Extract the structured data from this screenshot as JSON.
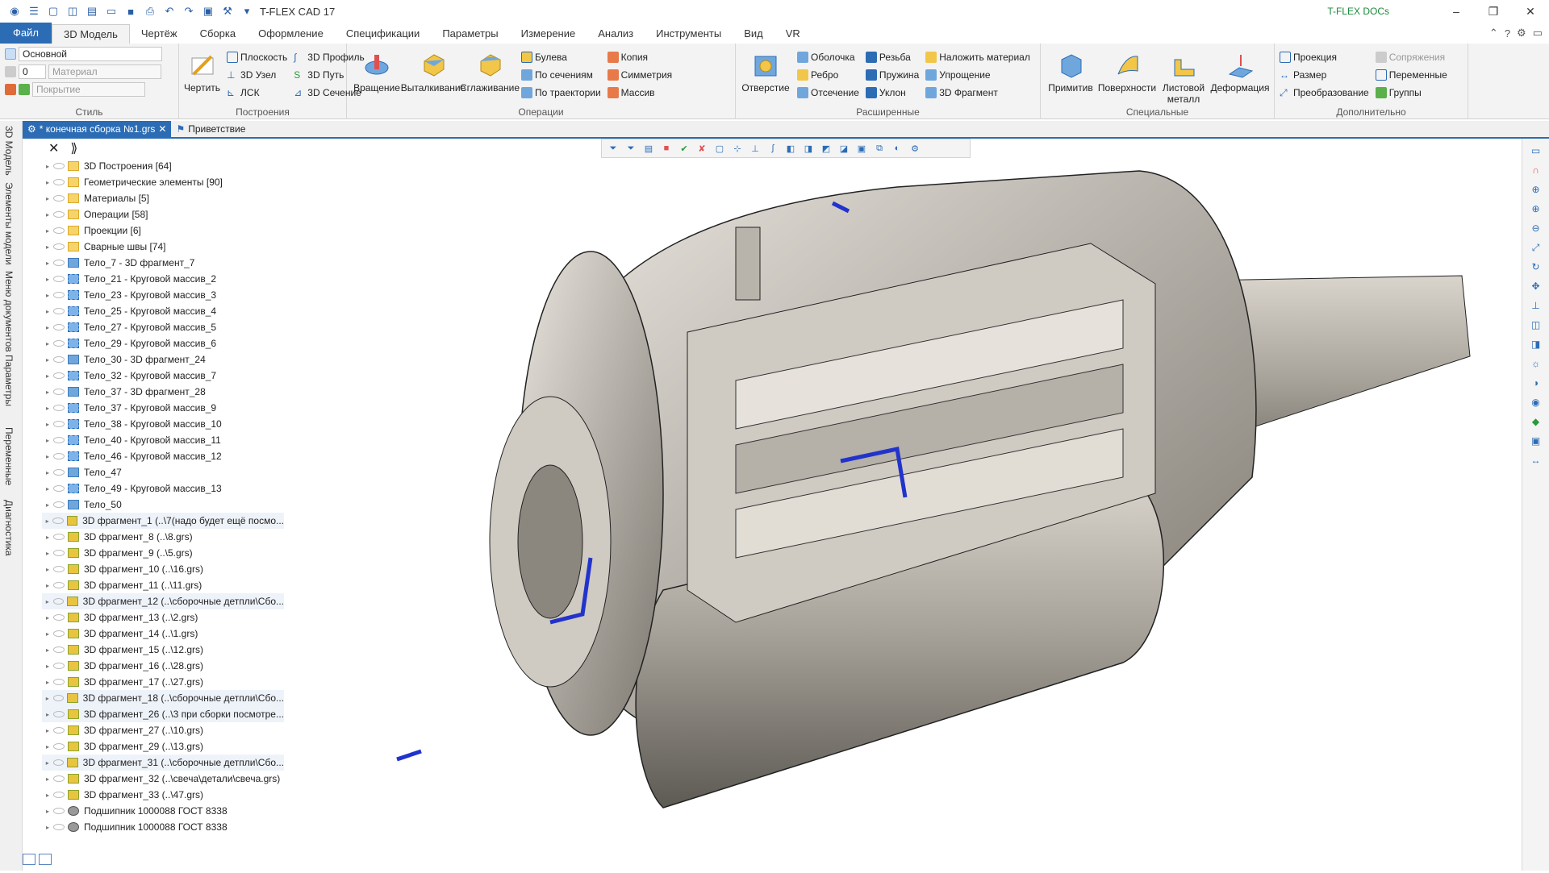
{
  "app": {
    "title": "T-FLEX CAD 17",
    "docs_label": "T-FLEX DOCs"
  },
  "menu_tabs": [
    "Файл",
    "3D Модель",
    "Чертёж",
    "Сборка",
    "Оформление",
    "Спецификации",
    "Параметры",
    "Измерение",
    "Анализ",
    "Инструменты",
    "Вид",
    "VR"
  ],
  "style_group": {
    "label": "Стиль",
    "layer": "Основной",
    "level": "0",
    "material_placeholder": "Материал",
    "cover_placeholder": "Покрытие"
  },
  "groups": {
    "build": {
      "label": "Построения",
      "big": "Чертить",
      "items": [
        "Плоскость",
        "3D Узел",
        "ЛСК",
        "3D Профиль",
        "3D Путь",
        "3D Сечение"
      ]
    },
    "ops": {
      "label": "Операции",
      "big": [
        "Вращение",
        "Выталкивание",
        "Сглаживание"
      ],
      "items": [
        "Булева",
        "По сечениям",
        "По траектории",
        "Копия",
        "Симметрия",
        "Массив"
      ]
    },
    "ext": {
      "label": "Расширенные",
      "big": "Отверстие",
      "items": [
        "Оболочка",
        "Ребро",
        "Отсечение",
        "Резьба",
        "Пружина",
        "Уклон",
        "Наложить материал",
        "Упрощение",
        "3D Фрагмент"
      ]
    },
    "spec": {
      "label": "Специальные",
      "big": [
        "Примитив",
        "Поверхности",
        "Листовой металл",
        "Деформация"
      ]
    },
    "add": {
      "label": "Дополнительно",
      "items": [
        "Проекция",
        "Размер",
        "Преобразование",
        "Сопряжения",
        "Переменные",
        "Группы"
      ]
    }
  },
  "doc_tabs": [
    "* конечная сборка №1.grs",
    "Приветствие"
  ],
  "side_tabs": [
    "3D Модель",
    "Элементы модели",
    "Меню документов",
    "Параметры",
    "Переменные",
    "Диагностика"
  ],
  "tree": [
    {
      "t": "3D Построения [64]",
      "k": "fold"
    },
    {
      "t": "Геометрические элементы [90]",
      "k": "fold"
    },
    {
      "t": "Материалы [5]",
      "k": "fold"
    },
    {
      "t": "Операции [58]",
      "k": "fold"
    },
    {
      "t": "Проекции [6]",
      "k": "fold"
    },
    {
      "t": "Сварные швы [74]",
      "k": "fold"
    },
    {
      "t": "Тело_7 - 3D фрагмент_7",
      "k": "body"
    },
    {
      "t": "Тело_21 - Круговой массив_2",
      "k": "arr"
    },
    {
      "t": "Тело_23 - Круговой массив_3",
      "k": "arr"
    },
    {
      "t": "Тело_25 - Круговой массив_4",
      "k": "arr"
    },
    {
      "t": "Тело_27 - Круговой массив_5",
      "k": "arr"
    },
    {
      "t": "Тело_29 - Круговой массив_6",
      "k": "arr"
    },
    {
      "t": "Тело_30 - 3D фрагмент_24",
      "k": "body"
    },
    {
      "t": "Тело_32 - Круговой массив_7",
      "k": "arr"
    },
    {
      "t": "Тело_37 - 3D фрагмент_28",
      "k": "body"
    },
    {
      "t": "Тело_37 - Круговой массив_9",
      "k": "arr"
    },
    {
      "t": "Тело_38 - Круговой массив_10",
      "k": "arr"
    },
    {
      "t": "Тело_40 - Круговой массив_11",
      "k": "arr"
    },
    {
      "t": "Тело_46 - Круговой массив_12",
      "k": "arr"
    },
    {
      "t": "Тело_47",
      "k": "body"
    },
    {
      "t": "Тело_49 - Круговой массив_13",
      "k": "arr"
    },
    {
      "t": "Тело_50",
      "k": "body"
    },
    {
      "t": "3D фрагмент_1 (..\\7(надо будет ещё посмо...",
      "k": "frag",
      "hl": true
    },
    {
      "t": "3D фрагмент_8 (..\\8.grs)",
      "k": "frag"
    },
    {
      "t": "3D фрагмент_9 (..\\5.grs)",
      "k": "frag"
    },
    {
      "t": "3D фрагмент_10 (..\\16.grs)",
      "k": "frag"
    },
    {
      "t": "3D фрагмент_11 (..\\11.grs)",
      "k": "frag"
    },
    {
      "t": "3D фрагмент_12 (..\\сборочные детпли\\Сбо...",
      "k": "frag",
      "hl": true
    },
    {
      "t": "3D фрагмент_13 (..\\2.grs)",
      "k": "frag"
    },
    {
      "t": "3D фрагмент_14 (..\\1.grs)",
      "k": "frag"
    },
    {
      "t": "3D фрагмент_15 (..\\12.grs)",
      "k": "frag"
    },
    {
      "t": "3D фрагмент_16 (..\\28.grs)",
      "k": "frag"
    },
    {
      "t": "3D фрагмент_17 (..\\27.grs)",
      "k": "frag"
    },
    {
      "t": "3D фрагмент_18 (..\\сборочные детпли\\Сбо...",
      "k": "frag",
      "hl": true
    },
    {
      "t": "3D фрагмент_26 (..\\3 при сборки посмотре...",
      "k": "frag",
      "hl": true
    },
    {
      "t": "3D фрагмент_27 (..\\10.grs)",
      "k": "frag"
    },
    {
      "t": "3D фрагмент_29 (..\\13.grs)",
      "k": "frag"
    },
    {
      "t": "3D фрагмент_31 (..\\сборочные детпли\\Сбо...",
      "k": "frag",
      "hl": true
    },
    {
      "t": "3D фрагмент_32 (..\\свеча\\детали\\свеча.grs)",
      "k": "frag"
    },
    {
      "t": "3D фрагмент_33 (..\\47.grs)",
      "k": "frag"
    },
    {
      "t": "Подшипник 1000088 ГОСТ 8338",
      "k": "bear"
    },
    {
      "t": "Подшипник 1000088 ГОСТ 8338",
      "k": "bear"
    }
  ],
  "colors": {
    "accent": "#2b6cb5",
    "docs": "#1a8a3a"
  }
}
